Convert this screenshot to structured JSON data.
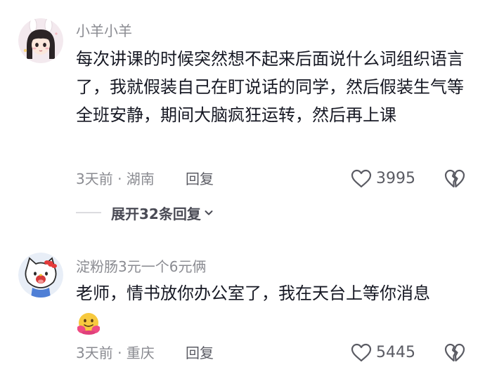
{
  "comments": [
    {
      "username": "小羊小羊",
      "text": "每次讲课的时候突然想不起来后面说什么词组织语言了，我就假装自己在盯说话的同学，然后假装生气等全班安静，期间大脑疯狂运转，然后再上课",
      "meta": "3天前 · 湖南",
      "reply_label": "回复",
      "likes": "3995",
      "avatar_icon": "anime-girl-avatar"
    },
    {
      "username": "淀粉肠3元一个6元俩",
      "text": "老师，情书放你办公室了，我在天台上等你消息",
      "emoji": "hugging-face-icon",
      "meta": "3天前 · 重庆",
      "reply_label": "回复",
      "likes": "5445",
      "avatar_icon": "hello-kitty-avatar"
    }
  ],
  "expand_replies": {
    "label": "展开32条回复"
  },
  "colors": {
    "text": "#161823",
    "secondary": "#8a8b91",
    "action": "#5a5b63"
  }
}
